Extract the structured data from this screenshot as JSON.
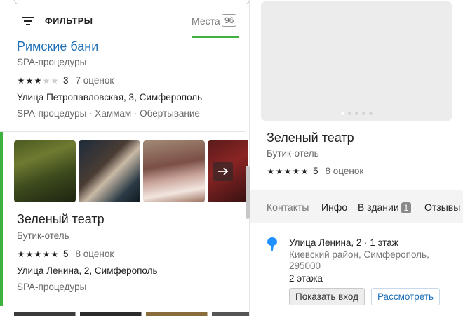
{
  "filters": {
    "label": "ФИЛЬТРЫ",
    "places_tab_label": "Места",
    "places_count": "96"
  },
  "results": [
    {
      "title": "Римские бани",
      "category": "SPA-процедуры",
      "rating_stars": 3,
      "rating_value": "3",
      "votes": "7 оценок",
      "address": "Улица Петропавловская, 3, Симферополь",
      "tags": "SPA-процедуры · Хаммам · Обертывание"
    },
    {
      "title": "Зеленый театр",
      "category": "Бутик-отель",
      "rating_stars": 5,
      "rating_value": "5",
      "votes": "8 оценок",
      "address": "Улица Ленина, 2, Симферополь",
      "tags": "SPA-процедуры",
      "photo_count": 4
    }
  ],
  "detail": {
    "title": "Зеленый театр",
    "category": "Бутик-отель",
    "rating_stars": 5,
    "rating_value": "5",
    "votes": "8 оценок",
    "gallery_dots": 5,
    "tabs": [
      {
        "label": "Контакты",
        "active": true
      },
      {
        "label": "Инфо",
        "active": false
      },
      {
        "label": "В здании",
        "badge": "1",
        "active": false
      },
      {
        "label": "Отзывы",
        "active": false
      }
    ],
    "address": "Улица Ленина, 2",
    "floor": "1 этаж",
    "district": "Киевский район, Симферополь, 295000",
    "floors_total": "2 этажа",
    "show_entrance_label": "Показать вход",
    "view_label": "Рассмотреть"
  },
  "colors": {
    "accent_green": "#3fb13f",
    "link_blue": "#1f70b8",
    "pin_blue": "#1e90ff"
  }
}
